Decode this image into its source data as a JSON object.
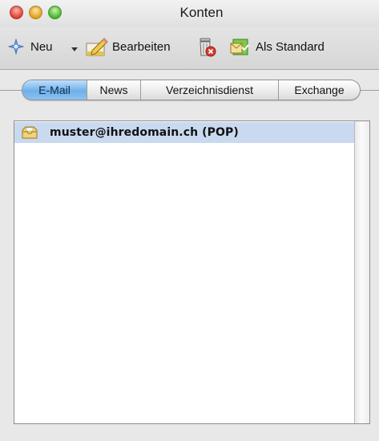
{
  "window": {
    "title": "Konten"
  },
  "toolbar": {
    "new_label": "Neu",
    "edit_label": "Bearbeiten",
    "default_label": "Als Standard"
  },
  "tabs": [
    {
      "label": "E-Mail",
      "selected": true
    },
    {
      "label": "News",
      "selected": false
    },
    {
      "label": "Verzeichnisdienst",
      "selected": false
    },
    {
      "label": "Exchange",
      "selected": false
    }
  ],
  "accounts": [
    {
      "label": "muster@ihredomain.ch (POP)",
      "selected": true,
      "icon": "mailbox-icon"
    }
  ],
  "colors": {
    "selection": "#c9d9ef",
    "active_tab": "#6fb0ea"
  }
}
